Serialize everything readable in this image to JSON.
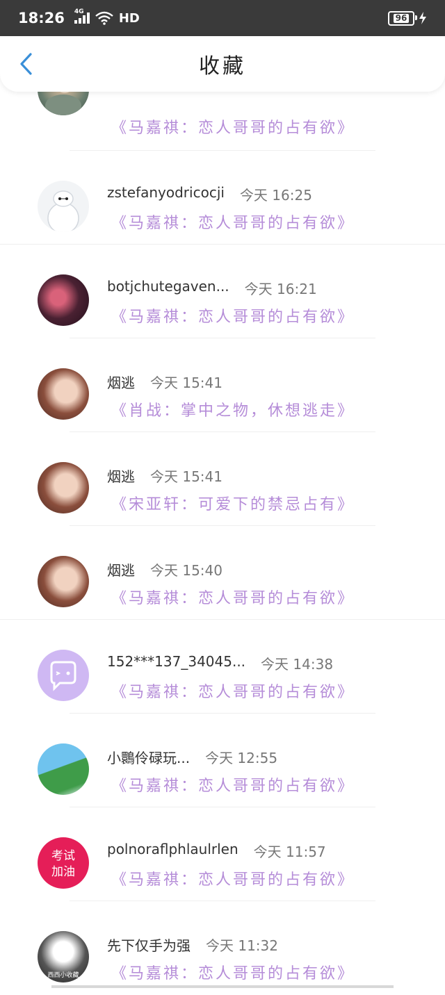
{
  "status_bar": {
    "time": "18:26",
    "network": "4G",
    "quality": "HD",
    "battery": "96"
  },
  "header": {
    "title": "收藏"
  },
  "items": [
    {
      "username": "",
      "time": "",
      "title": "《马嘉祺：恋人哥哥的占有欲》"
    },
    {
      "username": "zstefanyodricocji",
      "time": "今天 16:25",
      "title": "《马嘉祺：恋人哥哥的占有欲》"
    },
    {
      "username": "botjchutegaven...",
      "time": "今天 16:21",
      "title": "《马嘉祺：恋人哥哥的占有欲》"
    },
    {
      "username": "烟逃",
      "time": "今天 15:41",
      "title": "《肖战：掌中之物，休想逃走》"
    },
    {
      "username": "烟逃",
      "time": "今天 15:41",
      "title": "《宋亚轩：可爱下的禁忌占有》"
    },
    {
      "username": "烟逃",
      "time": "今天 15:40",
      "title": "《马嘉祺：恋人哥哥的占有欲》"
    },
    {
      "username": "152***137_34045...",
      "time": "今天 14:38",
      "title": "《马嘉祺：恋人哥哥的占有欲》"
    },
    {
      "username": "小䴉伶碌玩...",
      "time": "今天 12:55",
      "title": "《马嘉祺：恋人哥哥的占有欲》"
    },
    {
      "username": "polnoraflphlaulrlen",
      "time": "今天 11:57",
      "title": "《马嘉祺：恋人哥哥的占有欲》"
    },
    {
      "username": "先下仅手为强",
      "time": "今天 11:32",
      "title": "《马嘉祺：恋人哥哥的占有欲》"
    }
  ],
  "avatar_texts": {
    "exam_top": "考试",
    "exam_bottom": "加油",
    "watermark": "西西小收藏"
  },
  "colors": {
    "status_bar_bg": "#3a3a3a",
    "back_arrow": "#3a8fd8",
    "title_purple": "#b58cd8",
    "divider": "#efefef"
  }
}
